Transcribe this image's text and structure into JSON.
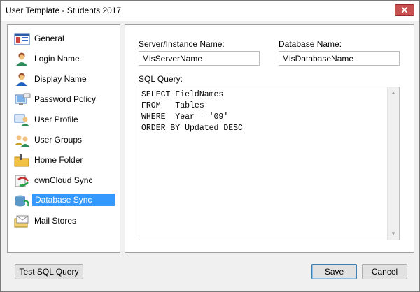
{
  "window": {
    "title": "User Template - Students 2017",
    "close_label": "✕"
  },
  "nav": {
    "items": [
      {
        "label": "General",
        "icon": "general-icon"
      },
      {
        "label": "Login Name",
        "icon": "login-name-icon"
      },
      {
        "label": "Display Name",
        "icon": "display-name-icon"
      },
      {
        "label": "Password Policy",
        "icon": "password-policy-icon"
      },
      {
        "label": "User Profile",
        "icon": "user-profile-icon"
      },
      {
        "label": "User Groups",
        "icon": "user-groups-icon"
      },
      {
        "label": "Home Folder",
        "icon": "home-folder-icon"
      },
      {
        "label": "ownCloud Sync",
        "icon": "owncloud-sync-icon"
      },
      {
        "label": "Database Sync",
        "icon": "database-sync-icon",
        "selected": true
      },
      {
        "label": "Mail Stores",
        "icon": "mail-stores-icon"
      }
    ]
  },
  "form": {
    "server_label": "Server/Instance Name:",
    "server_value": "MisServerName",
    "database_label": "Database Name:",
    "database_value": "MisDatabaseName",
    "sql_label": "SQL Query:",
    "sql_value": "SELECT FieldNames\nFROM   Tables\nWHERE  Year = '09'\nORDER BY Updated DESC"
  },
  "buttons": {
    "test_sql": "Test SQL Query",
    "save": "Save",
    "cancel": "Cancel"
  },
  "colors": {
    "selection": "#3399ff",
    "close": "#c75050"
  }
}
